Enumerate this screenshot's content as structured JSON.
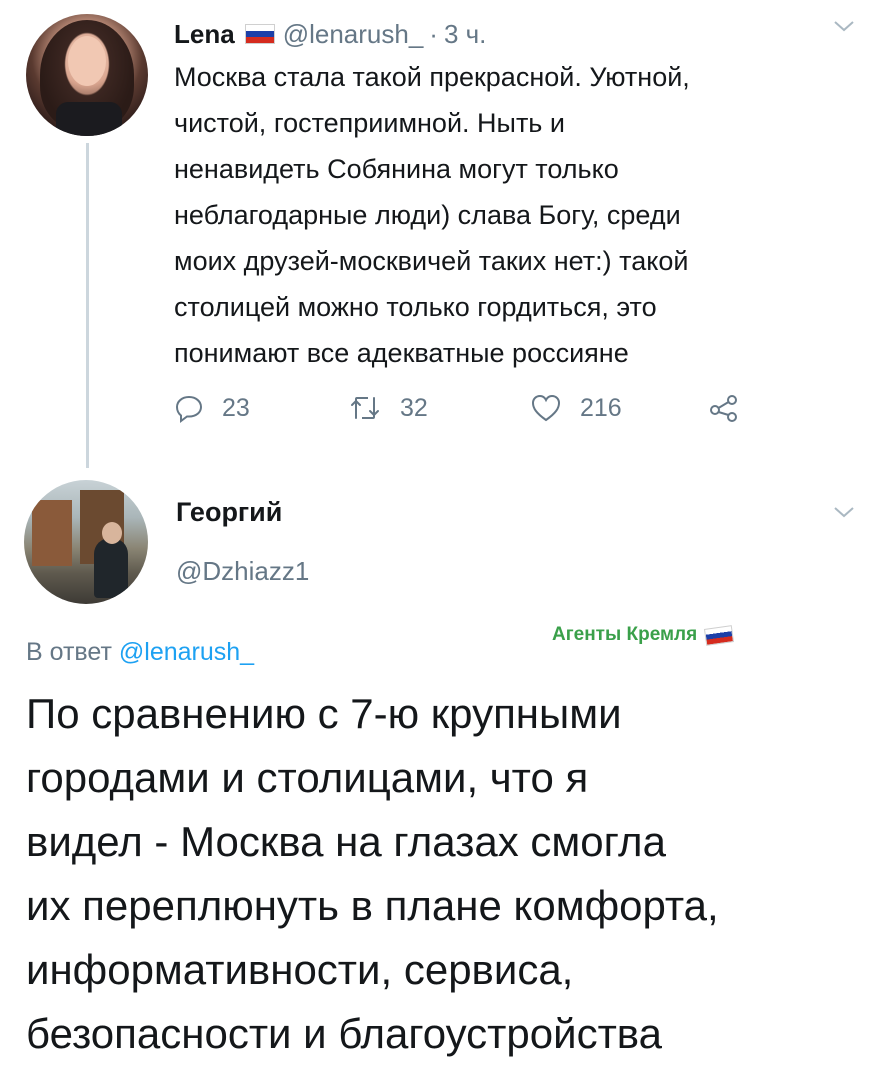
{
  "tweet": {
    "author_name": "Lena",
    "author_handle": "@lenarush_",
    "separator": "·",
    "time": "3 ч.",
    "text": "Москва стала такой прекрасной. Уютной,\nчистой, гостеприимной. Ныть и\nненавидеть Собянина могут только\nнеблагодарные люди) слава Богу, среди\nмоих друзей-москвичей таких нет:) такой\nстолицей можно только гордиться, это\nпонимают все адекватные россияне",
    "replies": "23",
    "retweets": "32",
    "likes": "216"
  },
  "reply": {
    "author_name": "Георгий",
    "author_handle": "@Dzhiazz1",
    "in_reply_prefix": "В ответ",
    "in_reply_handle": "@lenarush_",
    "text": "По сравнению с 7-ю крупными\nгородами и столицами, что я\nвидел - Москва на глазах смогла\nих переплюнуть в плане комфорта,\nинформативности, сервиса,\nбезопасности и благоустройства"
  },
  "watermark": {
    "label": "Агенты Кремля"
  },
  "icons": {
    "flag": "russian-flag-icon",
    "chevron": "chevron-down-icon",
    "reply": "reply-icon",
    "retweet": "retweet-icon",
    "like": "heart-icon",
    "share": "share-icon"
  },
  "colors": {
    "text": "#14171a",
    "secondary": "#657786",
    "link": "#1da1f2",
    "thread_line": "#ccd6dd",
    "watermark": "#3aa04a"
  }
}
